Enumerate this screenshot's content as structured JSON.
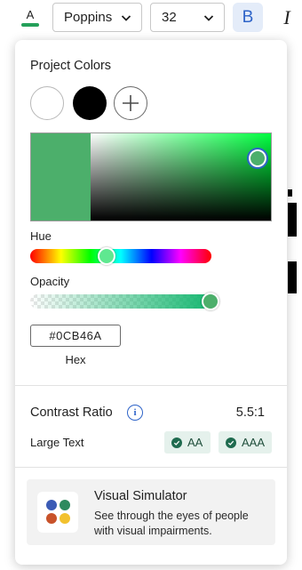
{
  "toolbar": {
    "text_color_letter": "A",
    "text_color": "#24a05a",
    "font_family": "Poppins",
    "font_size": "32",
    "bold_label": "B",
    "italic_label": "I"
  },
  "popover": {
    "project_colors_title": "Project Colors",
    "project_swatches": [
      "#ffffff",
      "#000000"
    ],
    "selected_color": "#4CAF6B",
    "hue_label": "Hue",
    "opacity_label": "Opacity",
    "opacity_percent": 100,
    "hex_value": "#0CB46A",
    "hex_label": "Hex",
    "contrast": {
      "title": "Contrast Ratio",
      "ratio": "5.5:1",
      "large_text_label": "Large Text",
      "badges": [
        "AA",
        "AAA"
      ]
    },
    "simulator": {
      "title": "Visual Simulator",
      "description": "See through the eyes of people with visual impairments.",
      "dot_colors": [
        "#3b5bb5",
        "#2e8a5e",
        "#c8522a",
        "#f2c12e"
      ]
    }
  },
  "colors": {
    "accent": "#2d63c8",
    "badge_bg": "#e5f1ec"
  }
}
